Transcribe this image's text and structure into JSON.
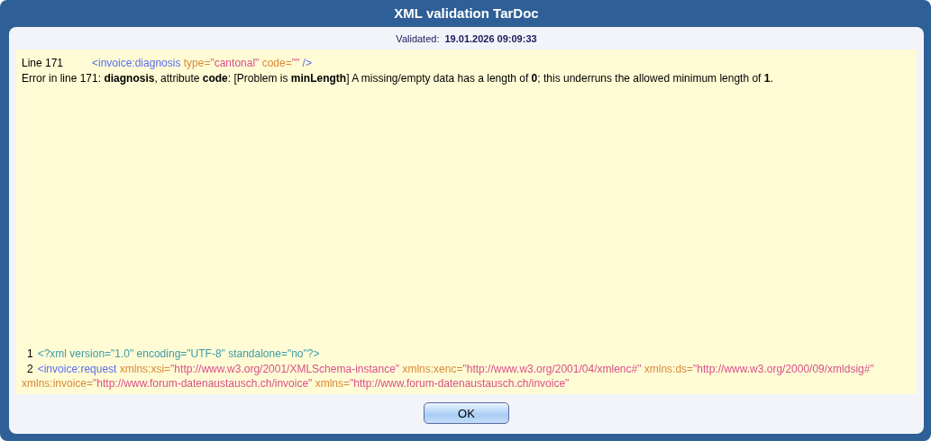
{
  "window": {
    "title": "XML validation TarDoc"
  },
  "validated": {
    "label": "Validated:",
    "timestamp": "19.01.2026 09:09:33"
  },
  "error": {
    "line_label": "Line 171",
    "snippet": [
      {
        "kind": "tag",
        "text": "<invoice:diagnosis"
      },
      {
        "kind": "attr",
        "text": " type="
      },
      {
        "kind": "value",
        "text": "\"cantonal\""
      },
      {
        "kind": "attr",
        "text": " code="
      },
      {
        "kind": "value",
        "text": "\"\""
      },
      {
        "kind": "tag",
        "text": " />"
      }
    ],
    "message": "Error in line 171: **diagnosis**, attribute **code**: [Problem is **minLength**] A missing/empty data has a length of **0**; this underruns the allowed minimum length of **1**."
  },
  "source_lines": [
    {
      "number": "1",
      "tokens": [
        {
          "kind": "decl",
          "text": "<?xml version=\"1.0\" encoding=\"UTF-8\" standalone=\"no\"?>"
        }
      ]
    },
    {
      "number": "2",
      "tokens": [
        {
          "kind": "tag",
          "text": "<invoice:request"
        },
        {
          "kind": "attr",
          "text": " xmlns:xsi="
        },
        {
          "kind": "value",
          "text": "\"http://www.w3.org/2001/XMLSchema-instance\""
        },
        {
          "kind": "attr",
          "text": " xmlns:xenc="
        },
        {
          "kind": "value",
          "text": "\"http://www.w3.org/2001/04/xmlenc#\""
        },
        {
          "kind": "attr",
          "text": " xmlns:ds="
        },
        {
          "kind": "value",
          "text": "\"http://www.w3.org/2000/09/xmldsig#\""
        },
        {
          "kind": "attr",
          "text": " xmlns:invoice="
        },
        {
          "kind": "value",
          "text": "\"http://www.forum-datenaustausch.ch/invoice\""
        },
        {
          "kind": "attr",
          "text": " xmlns="
        },
        {
          "kind": "value",
          "text": "\"http://www.forum-datenaustausch.ch/invoice\""
        }
      ]
    }
  ],
  "buttons": [
    {
      "label": "OK"
    }
  ]
}
